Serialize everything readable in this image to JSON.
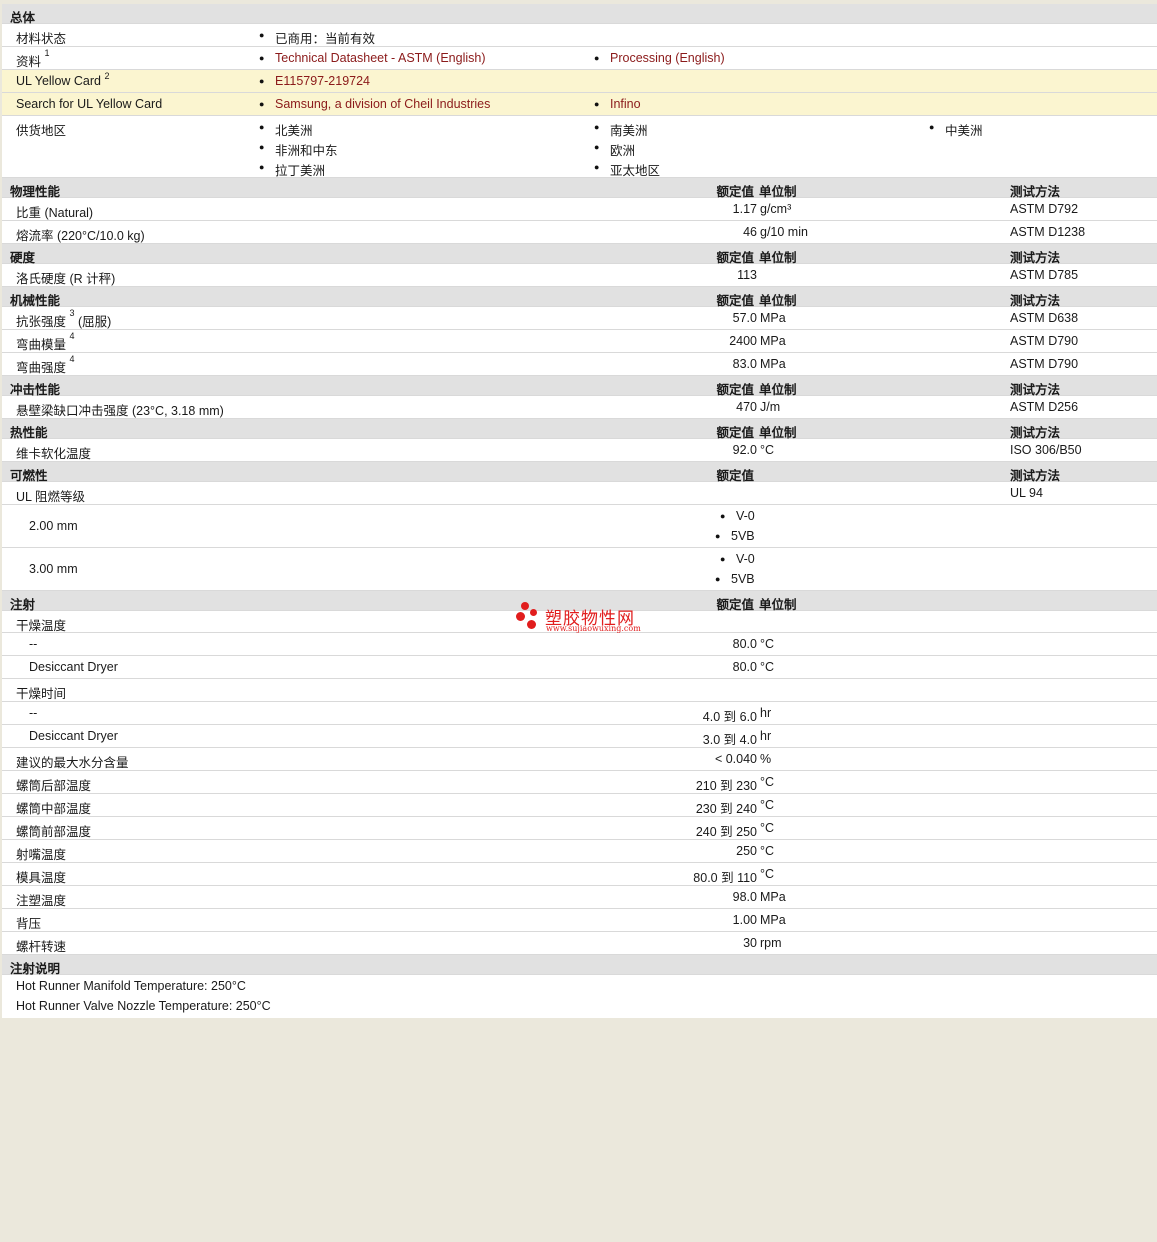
{
  "general": {
    "title": "总体",
    "status_label": "材料状态",
    "status_value": "已商用：当前有效",
    "docs_label": "资料",
    "docs_sup": "1",
    "docs_links": [
      "Technical Datasheet - ASTM (English)",
      "Processing (English)"
    ],
    "ul_label": "UL Yellow Card",
    "ul_sup": "2",
    "ul_link": "E115797-219724",
    "search_label": "Search for UL Yellow Card",
    "search_links": [
      "Samsung, a division of Cheil Industries",
      "Infino"
    ],
    "supply_label": "供货地区",
    "regions": [
      "北美洲",
      "南美洲",
      "中美洲",
      "非洲和中东",
      "欧洲",
      "拉丁美洲",
      "亚太地区"
    ]
  },
  "headers": {
    "value": "额定值",
    "unit": "单位制",
    "method": "测试方法"
  },
  "physical": {
    "title": "物理性能",
    "rows": [
      {
        "label": "比重 (Natural)",
        "value": "1.17",
        "unit": "g/cm³",
        "method": "ASTM D792"
      },
      {
        "label": "熔流率 (220°C/10.0 kg)",
        "value": "46",
        "unit": "g/10 min",
        "method": "ASTM D1238"
      }
    ]
  },
  "hardness": {
    "title": "硬度",
    "rows": [
      {
        "label": "洛氏硬度 (R 计秤)",
        "value": "113",
        "unit": "",
        "method": "ASTM D785"
      }
    ]
  },
  "mechanical": {
    "title": "机械性能",
    "rows": [
      {
        "label": "抗张强度",
        "sup": "3",
        "suffix": "(屈服)",
        "value": "57.0",
        "unit": "MPa",
        "method": "ASTM D638"
      },
      {
        "label": "弯曲模量",
        "sup": "4",
        "suffix": "",
        "value": "2400",
        "unit": "MPa",
        "method": "ASTM D790"
      },
      {
        "label": "弯曲强度",
        "sup": "4",
        "suffix": "",
        "value": "83.0",
        "unit": "MPa",
        "method": "ASTM D790"
      }
    ]
  },
  "impact": {
    "title": "冲击性能",
    "rows": [
      {
        "label": "悬壁梁缺口冲击强度 (23°C, 3.18 mm)",
        "value": "470",
        "unit": "J/m",
        "method": "ASTM D256"
      }
    ]
  },
  "thermal": {
    "title": "热性能",
    "rows": [
      {
        "label": "维卡软化温度",
        "value": "92.0",
        "unit": "°C",
        "method": "ISO 306/B50"
      }
    ]
  },
  "flammability": {
    "title": "可燃性",
    "ul_label": "UL 阻燃等级",
    "ul_method": "UL 94",
    "rows": [
      {
        "label": "2.00 mm",
        "values": [
          "V-0",
          "5VB"
        ]
      },
      {
        "label": "3.00 mm",
        "values": [
          "V-0",
          "5VB"
        ]
      }
    ]
  },
  "injection": {
    "title": "注射",
    "drying_temp_label": "干燥温度",
    "drying_temp_rows": [
      {
        "label": "--",
        "value": "80.0",
        "unit": "°C"
      },
      {
        "label": "Desiccant Dryer",
        "value": "80.0",
        "unit": "°C"
      }
    ],
    "drying_time_label": "干燥时间",
    "drying_time_rows": [
      {
        "label": "--",
        "value": "4.0 到  6.0",
        "unit": "hr"
      },
      {
        "label": "Desiccant Dryer",
        "value": "3.0 到  4.0",
        "unit": "hr"
      }
    ],
    "rows": [
      {
        "label": "建议的最大水分含量",
        "value": "< 0.040",
        "unit": "%"
      },
      {
        "label": "螺筒后部温度",
        "value": "210 到  230",
        "unit": "°C"
      },
      {
        "label": "螺筒中部温度",
        "value": "230 到  240",
        "unit": "°C"
      },
      {
        "label": "螺筒前部温度",
        "value": "240 到  250",
        "unit": "°C"
      },
      {
        "label": "射嘴温度",
        "value": "250",
        "unit": "°C"
      },
      {
        "label": "模具温度",
        "value": "80.0 到  110",
        "unit": "°C"
      },
      {
        "label": "注塑温度",
        "value": "98.0",
        "unit": "MPa"
      },
      {
        "label": "背压",
        "value": "1.00",
        "unit": "MPa"
      },
      {
        "label": "螺杆转速",
        "value": "30",
        "unit": "rpm"
      }
    ]
  },
  "notes": {
    "title": "注射说明",
    "lines": [
      "Hot Runner Manifold Temperature: 250°C",
      "Hot Runner Valve Nozzle Temperature: 250°C"
    ]
  },
  "watermark": {
    "name": "塑胶物性网",
    "url": "www.sujiaowuxing.com"
  },
  "colors": {
    "link": "#8b1a1a",
    "section_bg": "#e1e1e1",
    "highlight_bg": "#fbf5d0",
    "watermark": "#e11d1d"
  }
}
